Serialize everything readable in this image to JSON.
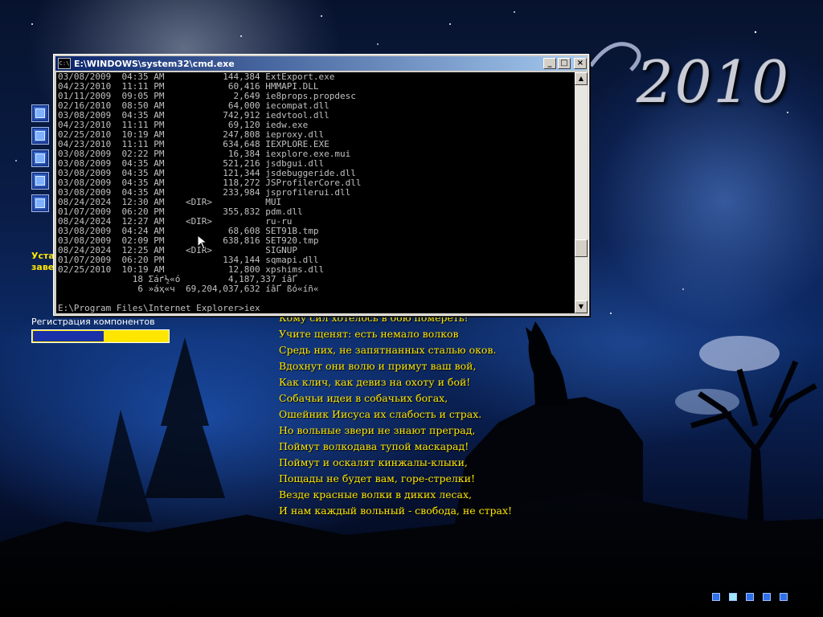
{
  "desktop": {
    "year": "2010",
    "sidebar_texts": [
      "Уста",
      "заве"
    ],
    "registration": {
      "label": "Регистрация компонентов",
      "progress": 0.52
    },
    "poem_lines": [
      "Кому сил хотелось в бою помереть!",
      "Учите щенят: есть немало волков",
      "Средь них, не запятнанных сталью оков.",
      "Вдохнут они волю и примут ваш вой,",
      "Как клич, как девиз на охоту и бой!",
      "Собачьи идеи в собачьих богах,",
      "Ошейник Иисуса их слабость и страх.",
      "Но вольные звери не знают преград,",
      "Поймут волкодава тупой маскарад!",
      "Поймут и оскалят кинжалы-клыки,",
      "Пощады не будет вам, горе-стрелки!",
      "Везде красные волки в диких лесах,",
      "И нам каждый вольный - свобода, не страх!"
    ]
  },
  "cmd_window": {
    "title": "E:\\WINDOWS\\system32\\cmd.exe",
    "buttons": {
      "minimize": "_",
      "maximize": "□",
      "close": "×"
    },
    "lines": [
      "03/08/2009  04:35 AM           144,384 ExtExport.exe",
      "04/23/2010  11:11 PM            60,416 HMMAPI.DLL",
      "01/11/2009  09:05 PM             2,649 ie8props.propdesc",
      "02/16/2010  08:50 AM            64,000 iecompat.dll",
      "03/08/2009  04:35 AM           742,912 iedvtool.dll",
      "04/23/2010  11:11 PM            69,120 iedw.exe",
      "02/25/2010  10:19 AM           247,808 ieproxy.dll",
      "04/23/2010  11:11 PM           634,648 IEXPLORE.EXE",
      "03/08/2009  02:22 PM            16,384 iexplore.exe.mui",
      "03/08/2009  04:35 AM           521,216 jsdbgui.dll",
      "03/08/2009  04:35 AM           121,344 jsdebuggeride.dll",
      "03/08/2009  04:35 AM           118,272 JSProfilerCore.dll",
      "03/08/2009  04:35 AM           233,984 jsprofilerui.dll",
      "08/24/2024  12:30 AM    <DIR>          MUI",
      "01/07/2009  06:20 PM           355,832 pdm.dll",
      "08/24/2024  12:27 AM    <DIR>          ru-ru",
      "03/08/2009  04:24 AM            68,608 SET91B.tmp",
      "03/08/2009  02:09 PM           638,816 SET920.tmp",
      "08/24/2024  12:25 AM    <DIR>          SIGNUP",
      "01/07/2009  06:20 PM           134,144 sqmapi.dll",
      "02/25/2010  10:19 AM            12,800 xpshims.dll",
      "              18 Σáґ½«ó         4,187,337 íâҐ",
      "               6 »áҳ«ч  69,204,037,632 íâҐ ßó«íñ«"
    ],
    "prompt": "E:\\Program Files\\Internet Explorer>iex"
  },
  "tray": {
    "icon_count": 5,
    "active_index": 1
  }
}
